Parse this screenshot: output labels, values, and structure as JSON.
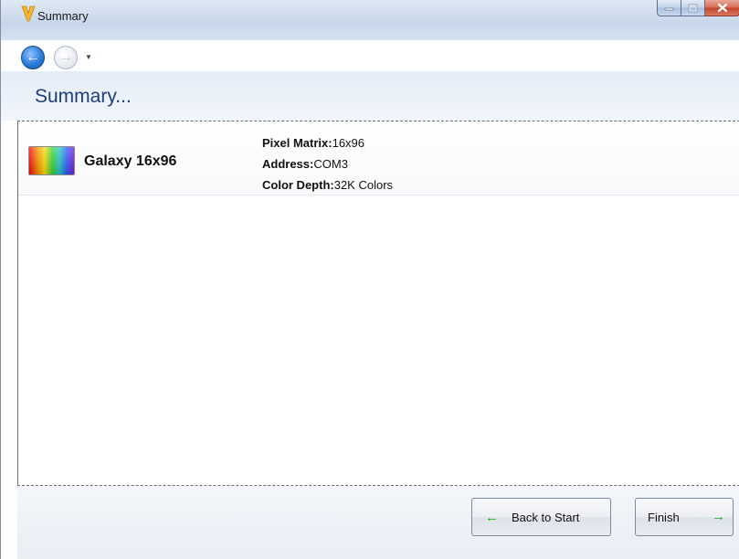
{
  "window": {
    "title": "Summary",
    "app_icon": "app-v-logo-icon",
    "caption_buttons": [
      "minimize-icon",
      "maximize-icon",
      "close-icon"
    ]
  },
  "nav": {
    "back_icon": "back-arrow-icon",
    "forward_icon": "forward-arrow-icon",
    "history_dropdown_icon": "chevron-down-icon"
  },
  "page": {
    "heading": "Summary..."
  },
  "device": {
    "name": "Galaxy 16x96",
    "thumbnail_icon": "rainbow-led-panel-icon",
    "specs": [
      {
        "label": "Pixel Matrix:",
        "value": "16x96"
      },
      {
        "label": "Address:",
        "value": "COM3"
      },
      {
        "label": "Color Depth:",
        "value": "32K Colors"
      }
    ]
  },
  "footer": {
    "back_button_label": "Back to Start",
    "finish_button_label": "Finish",
    "arrow_color": "#1fae1f"
  }
}
